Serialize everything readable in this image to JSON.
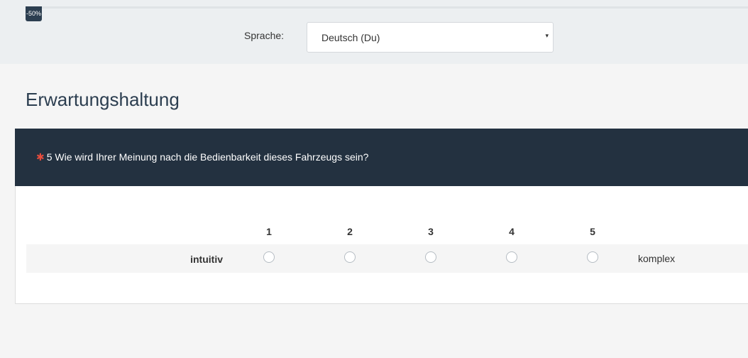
{
  "progress": {
    "label": "-50%",
    "percent": 50
  },
  "language": {
    "label": "Sprache:",
    "selected": "Deutsch (Du)",
    "arrow_icon": "▾"
  },
  "group": {
    "title": "Erwartungshaltung"
  },
  "question": {
    "required_icon": "✱",
    "text": "5 Wie wird Ihrer Meinung nach die Bedienbarkeit dieses Fahrzeugs sein?",
    "scale": [
      "1",
      "2",
      "3",
      "4",
      "5"
    ],
    "row": {
      "left_label": "intuitiv",
      "right_label": "komplex"
    }
  },
  "colors": {
    "header_bg": "#233140",
    "required": "#e74c3c",
    "title": "#2c3e50"
  }
}
